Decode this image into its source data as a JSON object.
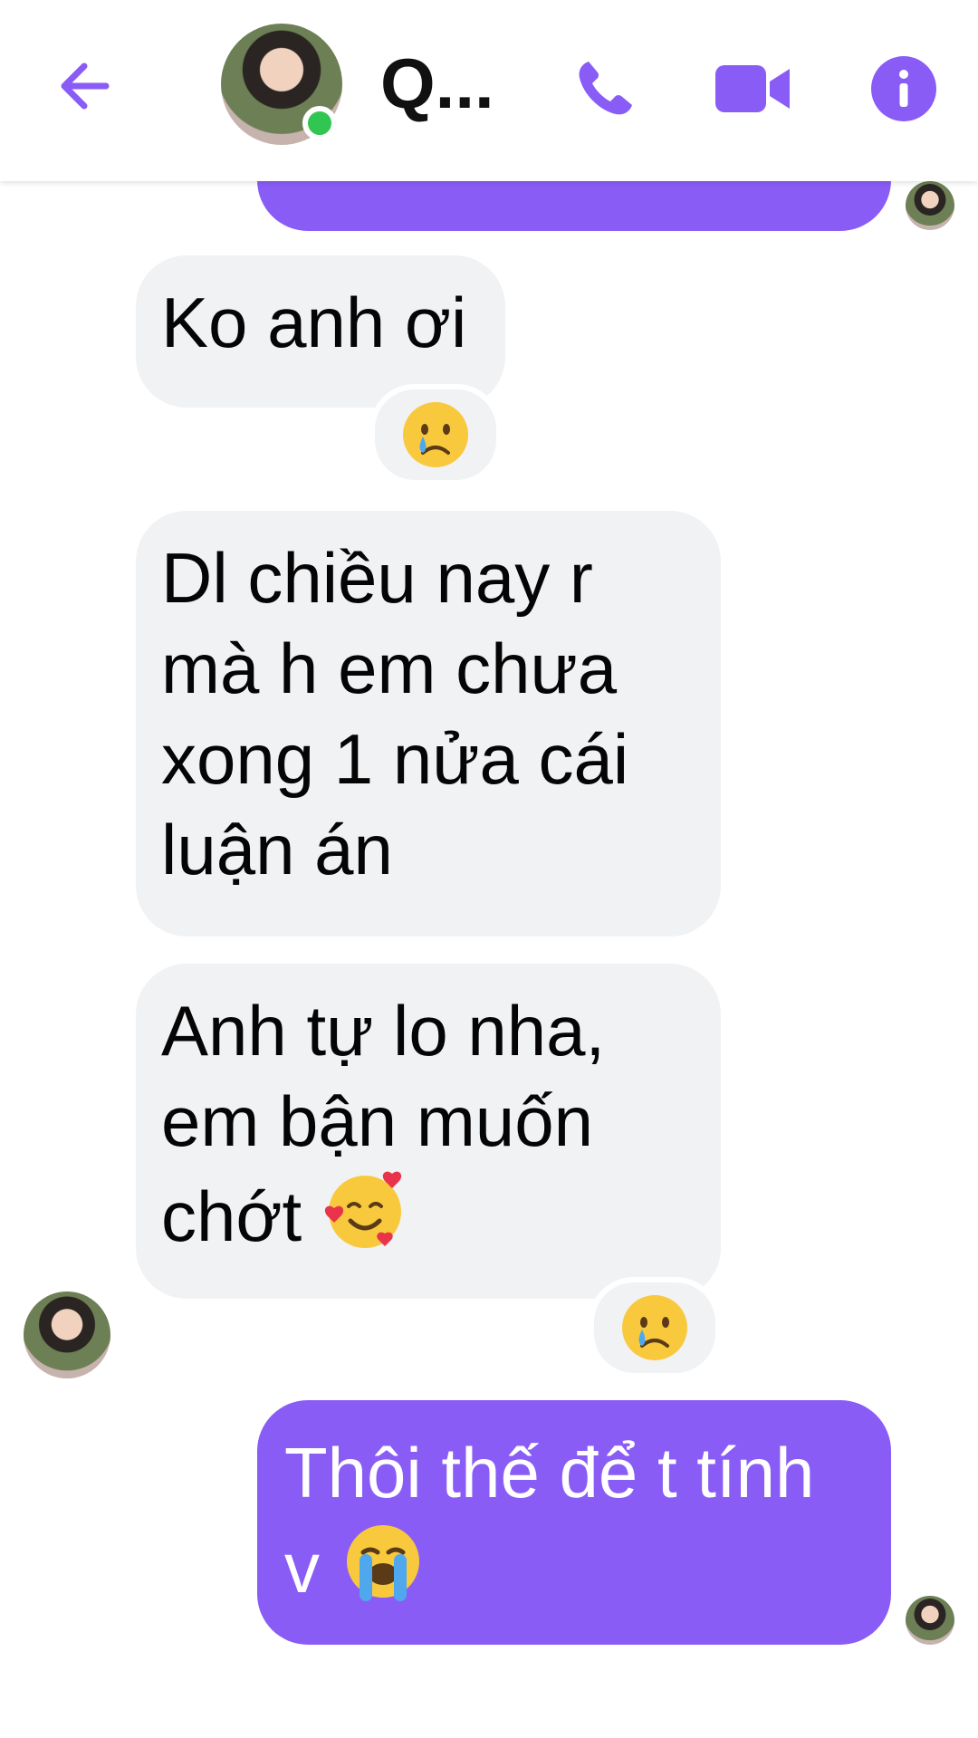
{
  "header": {
    "contact_name": "Q...",
    "status": "online"
  },
  "colors": {
    "accent": "#8a5cf6",
    "incoming_bubble": "#f1f2f4",
    "online": "#31c652"
  },
  "icons": {
    "back": "back-arrow-icon",
    "call": "phone-icon",
    "video": "video-camera-icon",
    "info": "info-icon"
  },
  "messages": [
    {
      "direction": "out",
      "text": ""
    },
    {
      "direction": "in",
      "text": "Ko anh ơi",
      "reaction": "crying-face"
    },
    {
      "direction": "in",
      "text": "Dl chiều nay r mà h em chưa xong 1 nửa cái luận án"
    },
    {
      "direction": "in",
      "text": "Anh tự lo nha, em bận muốn chớt",
      "emoji": "smiling-face-with-hearts",
      "reaction": "crying-face"
    },
    {
      "direction": "out",
      "text": "Thôi thế để t tính v",
      "emoji": "loudly-crying-face"
    }
  ]
}
